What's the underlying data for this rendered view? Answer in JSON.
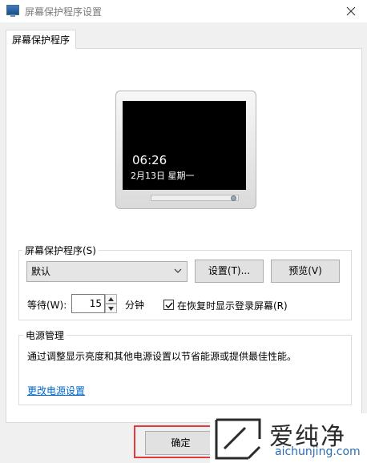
{
  "window": {
    "title": "屏幕保护程序设置"
  },
  "tabs": [
    {
      "label": "屏幕保护程序"
    }
  ],
  "preview": {
    "time": "06:26",
    "date": "2月13日 星期一"
  },
  "screensaver_group": {
    "legend": "屏幕保护程序(S)",
    "selected": "默认",
    "settings_button": "设置(T)...",
    "preview_button": "预览(V)",
    "wait_label": "等待(W):",
    "wait_value": "15",
    "wait_unit": "分钟",
    "resume_checkbox_label": "在恢复时显示登录屏幕(R)",
    "resume_checked": true
  },
  "power_group": {
    "legend": "电源管理",
    "description": "通过调整显示亮度和其他电源设置以节省能源或提供最佳性能。",
    "link": "更改电源设置"
  },
  "footer": {
    "ok_button": "确定"
  },
  "watermark": {
    "text": "爱纯净",
    "url": "aichunjing.com"
  },
  "colors": {
    "highlight": "#e13b3b",
    "link": "#0066cc",
    "screen": "#000000"
  }
}
